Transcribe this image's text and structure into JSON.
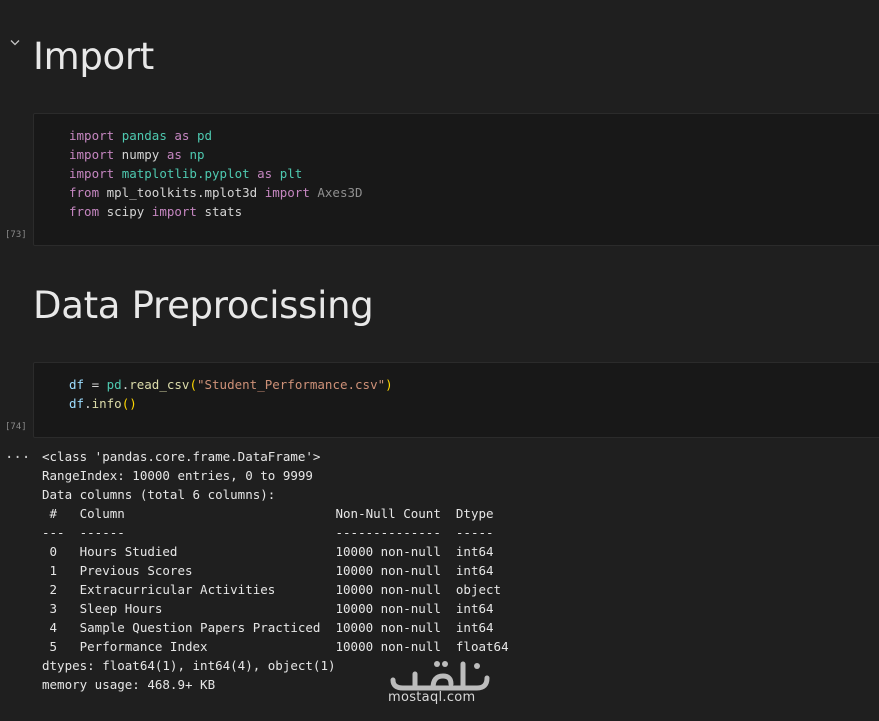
{
  "sections": [
    {
      "heading": "Import"
    },
    {
      "heading": "Data Preprocissing"
    }
  ],
  "cells": [
    {
      "execution_count": "[73]"
    },
    {
      "execution_count": "[74]"
    }
  ],
  "output": {
    "more_label": "...",
    "lines": [
      "<class 'pandas.core.frame.DataFrame'>",
      "RangeIndex: 10000 entries, 0 to 9999",
      "Data columns (total 6 columns):",
      " #   Column                            Non-Null Count  Dtype ",
      "---  ------                            --------------  ----- ",
      " 0   Hours Studied                     10000 non-null  int64 ",
      " 1   Previous Scores                   10000 non-null  int64 ",
      " 2   Extracurricular Activities        10000 non-null  object",
      " 3   Sleep Hours                       10000 non-null  int64 ",
      " 4   Sample Question Papers Practiced  10000 non-null  int64 ",
      " 5   Performance Index                 10000 non-null  float64",
      "dtypes: float64(1), int64(4), object(1)",
      "memory usage: 468.9+ KB"
    ]
  },
  "watermark": {
    "text": "mostaql.com"
  },
  "colors": {
    "background": "#1f1f1f",
    "cell_background": "#181818",
    "keyword": "#c586c0",
    "module": "#4ec9b0",
    "function": "#dcdcaa",
    "string": "#ce9178"
  },
  "icons": [
    "chevron-down-icon"
  ]
}
